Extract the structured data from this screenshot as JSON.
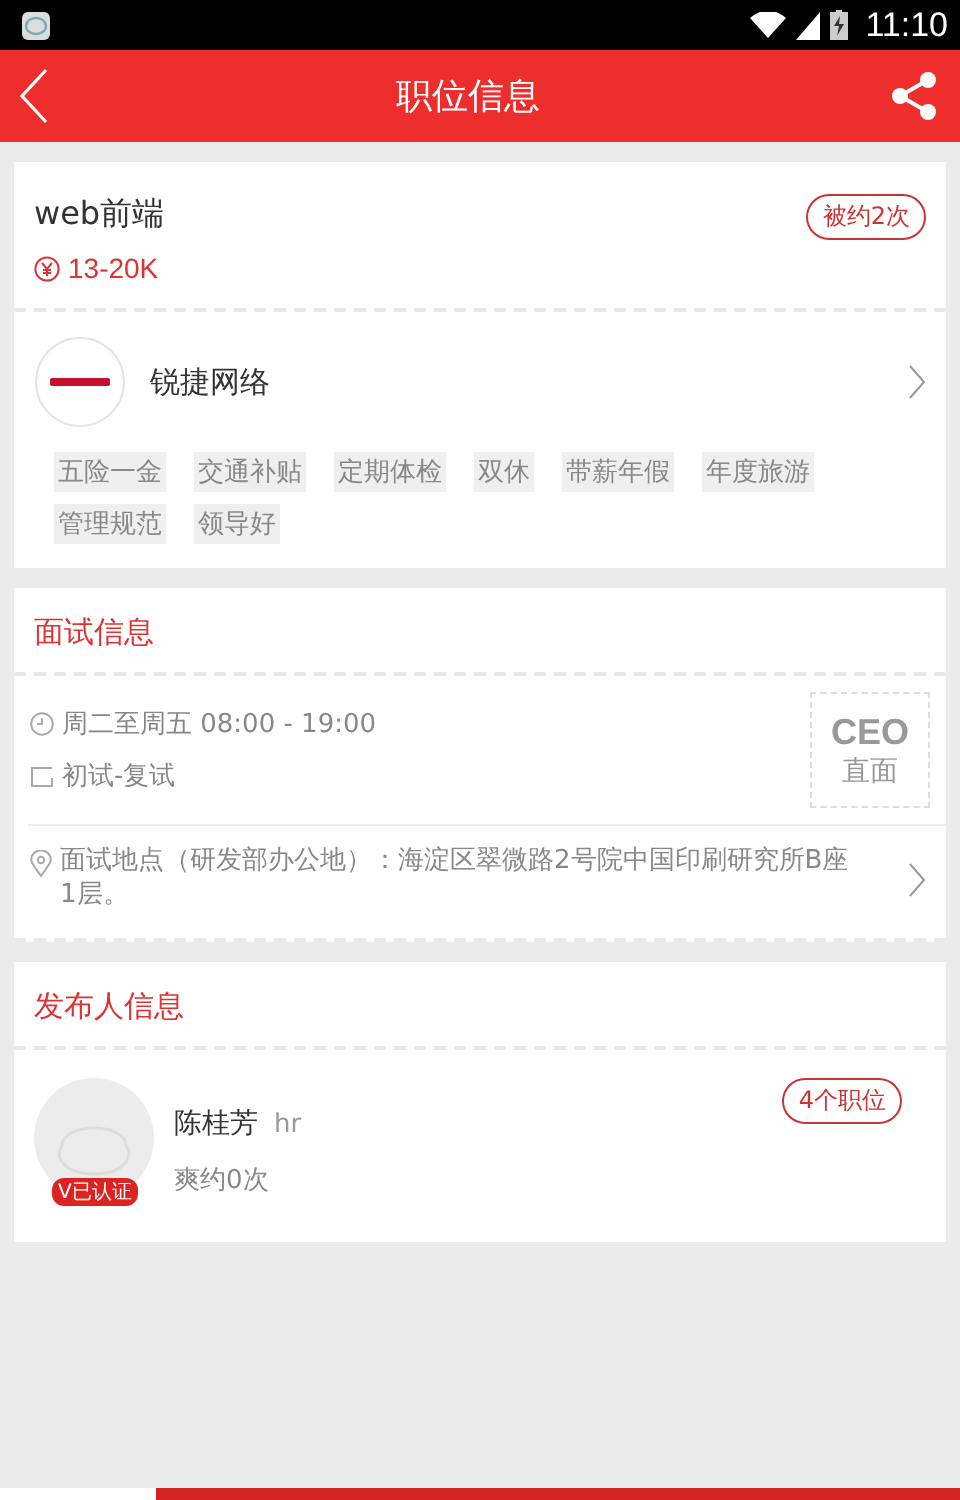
{
  "status_bar": {
    "time": "11:10"
  },
  "header": {
    "title": "职位信息"
  },
  "job": {
    "title": "web前端",
    "salary": "13-20K",
    "booked_badge": "被约2次"
  },
  "company": {
    "name": "锐捷网络",
    "tags": [
      "五险一金",
      "交通补贴",
      "定期体检",
      "双休",
      "带薪年假",
      "年度旅游",
      "管理规范",
      "领导好"
    ]
  },
  "interview": {
    "heading": "面试信息",
    "time": "周二至周五 08:00 - 19:00",
    "rounds": "初试-复试",
    "badge_top": "CEO",
    "badge_bottom": "直面",
    "location": "面试地点（研发部办公地）：海淀区翠微路2号院中国印刷研究所B座1层。"
  },
  "publisher": {
    "heading": "发布人信息",
    "name": "陈桂芳",
    "role": "hr",
    "stat": "爽约0次",
    "verified_badge": "V已认证",
    "jobs_badge": "4个职位"
  }
}
